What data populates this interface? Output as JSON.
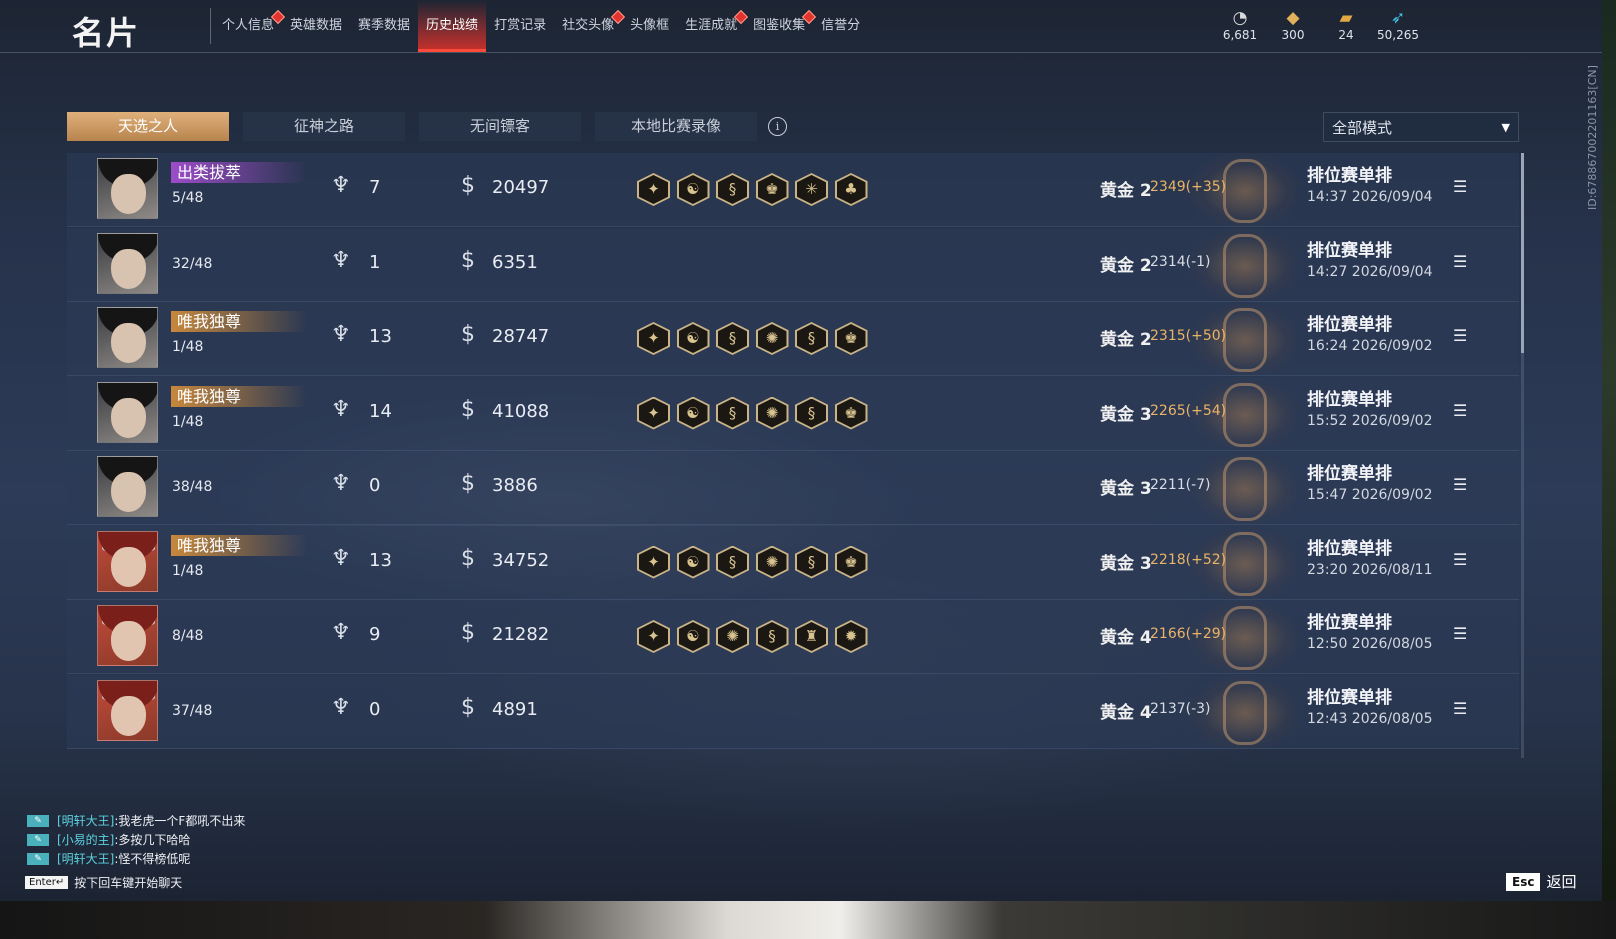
{
  "header": {
    "title": "名片",
    "tabs": [
      {
        "label": "个人信息",
        "dot": true
      },
      {
        "label": "英雄数据",
        "dot": false
      },
      {
        "label": "赛季数据",
        "dot": false
      },
      {
        "label": "历史战绩",
        "dot": false,
        "active": true
      },
      {
        "label": "打赏记录",
        "dot": false
      },
      {
        "label": "社交头像",
        "dot": true
      },
      {
        "label": "头像框",
        "dot": false
      },
      {
        "label": "生涯成就",
        "dot": true
      },
      {
        "label": "图鉴收集",
        "dot": true
      },
      {
        "label": "信誉分",
        "dot": false
      }
    ],
    "currencies": [
      {
        "icon": "coin-stack-icon",
        "value": "6,681"
      },
      {
        "icon": "gold-ingot-icon",
        "value": "300"
      },
      {
        "icon": "ticket-icon",
        "value": "24"
      },
      {
        "icon": "feather-icon",
        "value": "50,265"
      }
    ]
  },
  "sub_tabs": [
    "天选之人",
    "征神之路",
    "无间镖客",
    "本地比赛录像"
  ],
  "mode_select": {
    "value": "全部模式"
  },
  "side_id": "ID:678867002201163[CN]",
  "matches": [
    {
      "avatar": "a",
      "badge": "出类拔萃",
      "badge_color": "purple",
      "rank": "5/48",
      "kills": "7",
      "gold": "20497",
      "items": [
        "✦",
        "☯",
        "§",
        "♚",
        "✳",
        "♣"
      ],
      "tier": "黄金 2",
      "score": "2349(+35)",
      "mode": "排位赛单排",
      "time": "14:37  2026/09/04"
    },
    {
      "avatar": "a",
      "badge": "",
      "badge_color": "",
      "rank": "32/48",
      "kills": "1",
      "gold": "6351",
      "items": [],
      "tier": "黄金 2",
      "score": "2314(-1)",
      "mode": "排位赛单排",
      "time": "14:27  2026/09/04"
    },
    {
      "avatar": "a",
      "badge": "唯我独尊",
      "badge_color": "gold",
      "rank": "1/48",
      "kills": "13",
      "gold": "28747",
      "items": [
        "✦",
        "☯",
        "§",
        "✺",
        "§",
        "♚"
      ],
      "tier": "黄金 2",
      "score": "2315(+50)",
      "mode": "排位赛单排",
      "time": "16:24  2026/09/02"
    },
    {
      "avatar": "a",
      "badge": "唯我独尊",
      "badge_color": "gold",
      "rank": "1/48",
      "kills": "14",
      "gold": "41088",
      "items": [
        "✦",
        "☯",
        "§",
        "✺",
        "§",
        "♚"
      ],
      "tier": "黄金 3",
      "score": "2265(+54)",
      "mode": "排位赛单排",
      "time": "15:52  2026/09/02"
    },
    {
      "avatar": "a",
      "badge": "",
      "badge_color": "",
      "rank": "38/48",
      "kills": "0",
      "gold": "3886",
      "items": [],
      "tier": "黄金 3",
      "score": "2211(-7)",
      "mode": "排位赛单排",
      "time": "15:47  2026/09/02"
    },
    {
      "avatar": "b",
      "badge": "唯我独尊",
      "badge_color": "gold",
      "rank": "1/48",
      "kills": "13",
      "gold": "34752",
      "items": [
        "✦",
        "☯",
        "§",
        "✺",
        "§",
        "♚"
      ],
      "tier": "黄金 3",
      "score": "2218(+52)",
      "mode": "排位赛单排",
      "time": "23:20  2026/08/11"
    },
    {
      "avatar": "b",
      "badge": "",
      "badge_color": "",
      "rank": "8/48",
      "kills": "9",
      "gold": "21282",
      "items": [
        "✦",
        "☯",
        "✺",
        "§",
        "♜",
        "✹"
      ],
      "tier": "黄金 4",
      "score": "2166(+29)",
      "mode": "排位赛单排",
      "time": "12:50  2026/08/05"
    },
    {
      "avatar": "b",
      "badge": "",
      "badge_color": "",
      "rank": "37/48",
      "kills": "0",
      "gold": "4891",
      "items": [],
      "tier": "黄金 4",
      "score": "2137(-3)",
      "mode": "排位赛单排",
      "time": "12:43  2026/08/05"
    }
  ],
  "chat": [
    {
      "name": "[明轩大王]",
      "text": ":我老虎一个F都吼不出来"
    },
    {
      "name": "[小易的主]",
      "text": ":多按几下哈哈"
    },
    {
      "name": "[明轩大王]",
      "text": ":怪不得榜低呢"
    }
  ],
  "chat_hint": {
    "key": "Enter↵",
    "text": "按下回车键开始聊天"
  },
  "back": {
    "key": "Esc",
    "label": "返回"
  }
}
